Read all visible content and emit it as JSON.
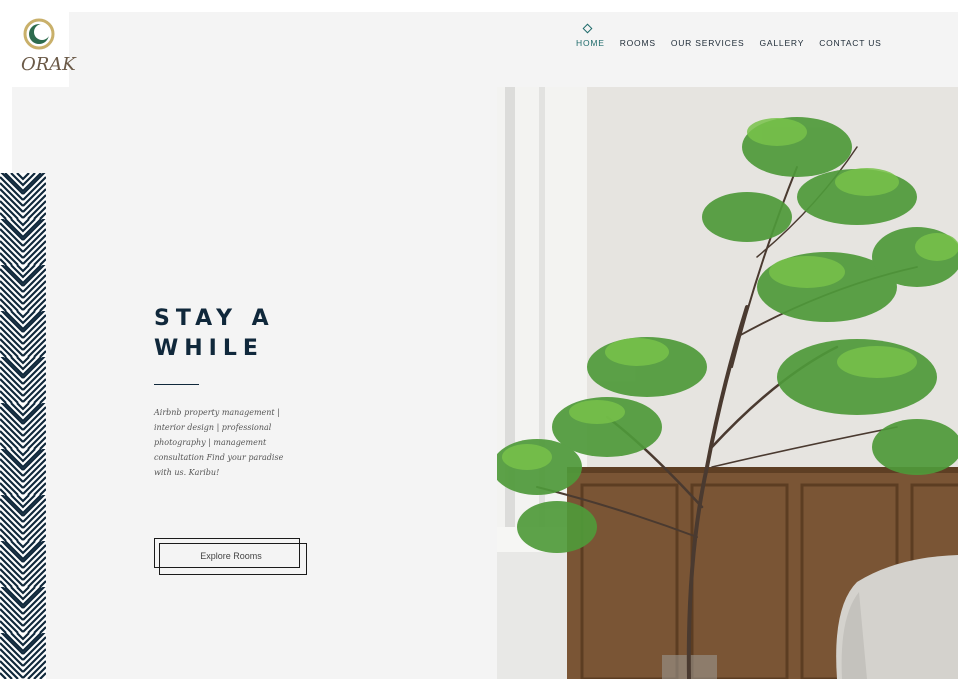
{
  "brand": {
    "logo_text": "ORAK",
    "logo_icon": "crescent-logo-icon"
  },
  "nav": {
    "items": [
      {
        "label": "HOME",
        "active": true
      },
      {
        "label": "ROOMS",
        "active": false
      },
      {
        "label": "OUR SERVICES",
        "active": false
      },
      {
        "label": "GALLERY",
        "active": false
      },
      {
        "label": "CONTACT US",
        "active": false
      }
    ]
  },
  "hero": {
    "title_line1": "STAY A",
    "title_line2": "WHILE",
    "description": "Airbnb property management | interior design | professional photography | management consultation Find your paradise with us. Karibu!",
    "cta_label": "Explore Rooms"
  },
  "colors": {
    "accent": "#1f6b6b",
    "navy": "#10283b",
    "background": "#f4f4f4"
  }
}
